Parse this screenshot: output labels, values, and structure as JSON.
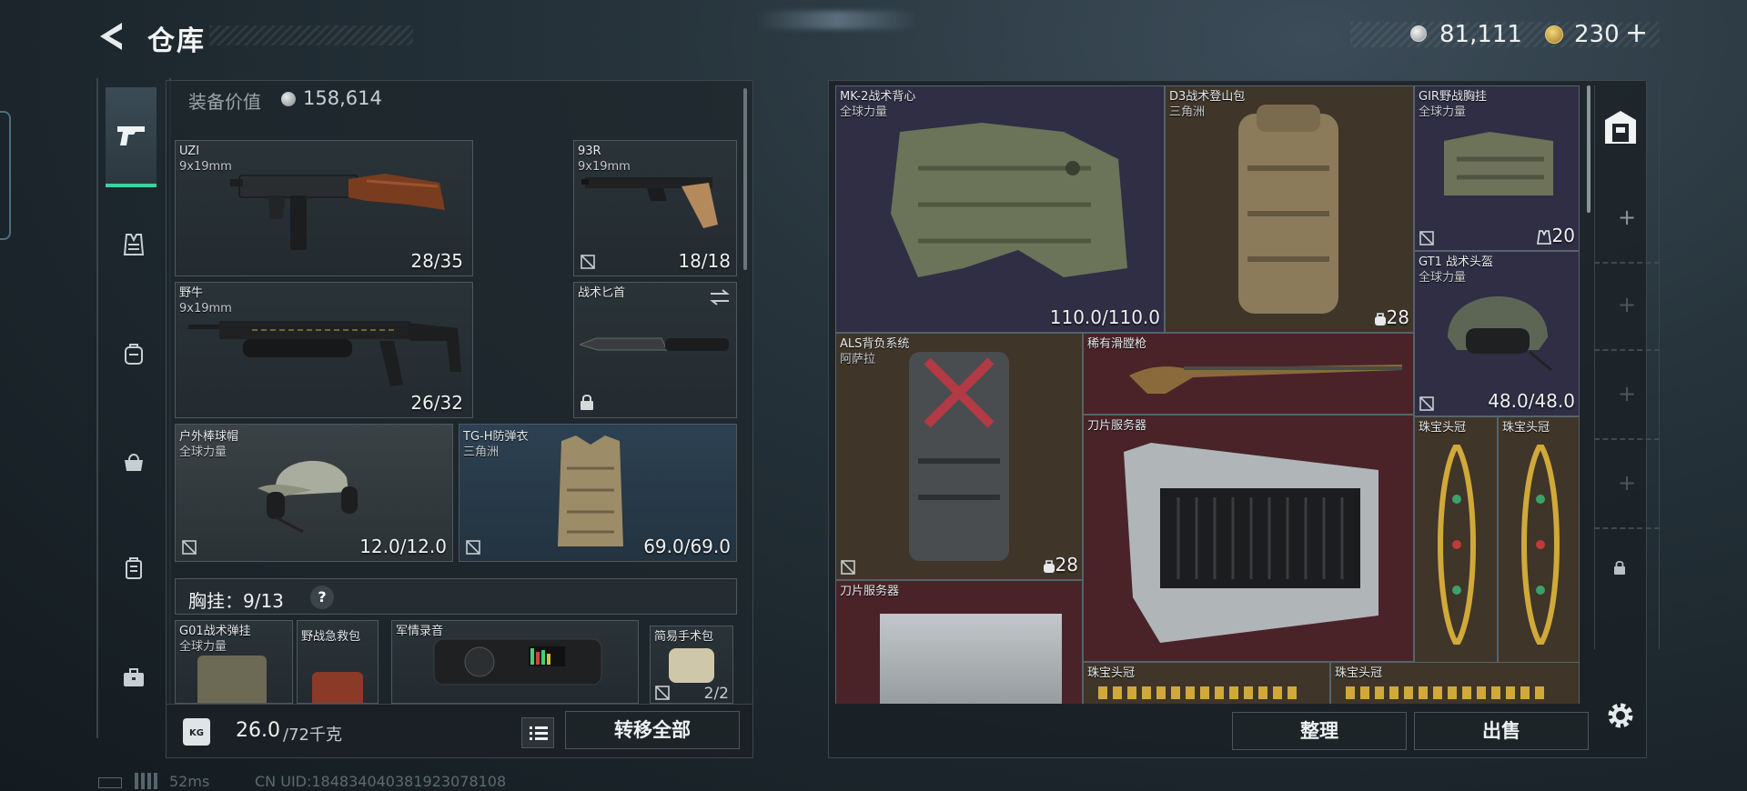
{
  "header": {
    "title": "仓库",
    "currency_value": "81,111",
    "coin_value": "230",
    "coin_plus": "+"
  },
  "nav": {
    "items": [
      "weapons",
      "vests",
      "backpacks",
      "bags",
      "cases",
      "toolbox"
    ]
  },
  "loadout": {
    "value_label": "装备价值",
    "value": "158,614",
    "weapons": [
      {
        "name": "UZI",
        "caliber": "9x19mm",
        "ammo": "28/35"
      },
      {
        "name": "93R",
        "caliber": "9x19mm",
        "ammo": "18/18"
      },
      {
        "name": "野牛",
        "caliber": "9x19mm",
        "ammo": "26/32"
      },
      {
        "name": "战术匕首"
      }
    ],
    "helmet": {
      "name": "户外棒球帽",
      "origin": "全球力量",
      "durability": "12.0/12.0"
    },
    "armor": {
      "name": "TG-H防弹衣",
      "origin": "三角洲",
      "durability": "69.0/69.0"
    },
    "rig_label": "胸挂：9/13",
    "rig_help": "?",
    "rig_items": [
      {
        "name": "G01战术弹挂",
        "origin": "全球力量"
      },
      {
        "name": "野战急救包"
      },
      {
        "name": "军情录音"
      },
      {
        "name": "简易手术包",
        "uses": "2/2"
      }
    ],
    "weight": "26.0",
    "weight_cap": "/72千克",
    "transfer_all": "转移全部"
  },
  "stash": {
    "items": [
      {
        "name": "MK-2战术背心",
        "origin": "全球力量",
        "durability": "110.0/110.0"
      },
      {
        "name": "D3战术登山包",
        "origin": "三角洲",
        "capacity": "28"
      },
      {
        "name": "GIR野战胸挂",
        "origin": "全球力量",
        "capacity": "20"
      },
      {
        "name": "GT1 战术头盔",
        "origin": "全球力量",
        "durability": "48.0/48.0"
      },
      {
        "name": "ALS背负系统",
        "origin": "阿萨拉",
        "capacity": "28"
      },
      {
        "name": "稀有滑膛枪"
      },
      {
        "name": "刀片服务器"
      },
      {
        "name": "珠宝头冠"
      },
      {
        "name": "珠宝头冠"
      },
      {
        "name": "刀片服务器"
      },
      {
        "name": "珠宝头冠"
      },
      {
        "name": "珠宝头冠"
      }
    ],
    "sort_label": "整理",
    "sell_label": "出售"
  },
  "footer": {
    "ping": "52ms",
    "uid": "CN UID:184834040381923078108"
  },
  "colors": {
    "accent": "#3fd0a0",
    "purple_cell": "#2f2e45",
    "red_cell": "#4a2328",
    "brown_cell": "#3f3529",
    "blue_cell": "#2b3b4b"
  }
}
